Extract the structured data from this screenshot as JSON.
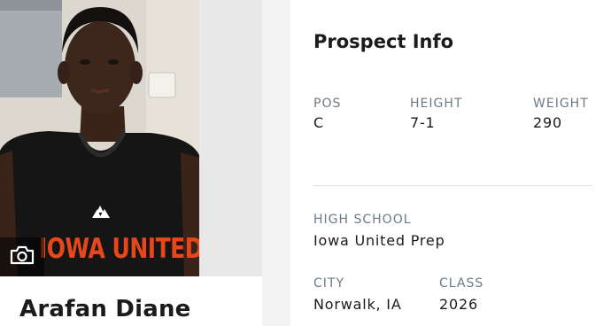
{
  "player": {
    "name": "Arafan Diane",
    "jersey_text": "IOWA UNITED"
  },
  "camera": {
    "icon": "camera-icon"
  },
  "prospect_info": {
    "title": "Prospect Info",
    "pos": {
      "label": "POS",
      "value": "C"
    },
    "height": {
      "label": "HEIGHT",
      "value": "7-1"
    },
    "weight": {
      "label": "WEIGHT",
      "value": "290"
    },
    "high_school": {
      "label": "HIGH SCHOOL",
      "value": "Iowa United Prep"
    },
    "city": {
      "label": "CITY",
      "value": "Norwalk, IA"
    },
    "class": {
      "label": "CLASS",
      "value": "2026"
    }
  },
  "colors": {
    "label_gray": "#6b7a86",
    "jersey_orange": "#e8471c",
    "page_bg": "#f3f3f3"
  }
}
